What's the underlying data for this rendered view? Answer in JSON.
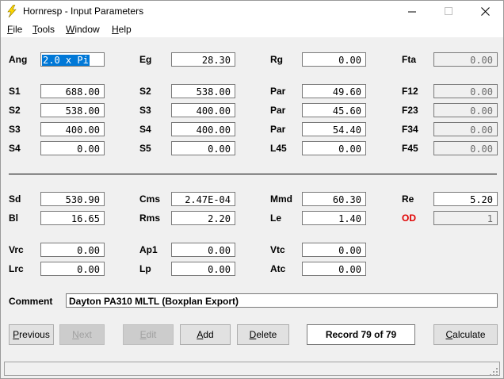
{
  "window": {
    "title": "Hornresp - Input Parameters",
    "minimize_glyph": "—",
    "maximize_glyph": "☐",
    "close_glyph": "✕",
    "icon": "lightning-bolt-icon",
    "icon_color": "#ffd800"
  },
  "menu": {
    "file": {
      "accel": "F",
      "rest": "ile"
    },
    "tools": {
      "accel": "T",
      "rest": "ools"
    },
    "window": {
      "accel": "W",
      "rest": "indow"
    },
    "help": {
      "accel": "H",
      "rest": "elp"
    }
  },
  "params": {
    "ang": {
      "label": "Ang",
      "value": "2.0 x Pi"
    },
    "eg": {
      "label": "Eg",
      "value": "28.30"
    },
    "rg": {
      "label": "Rg",
      "value": "0.00"
    },
    "fta": {
      "label": "Fta",
      "value": "0.00"
    },
    "s1a": {
      "label": "S1",
      "value": "688.00"
    },
    "s2b": {
      "label": "S2",
      "value": "538.00"
    },
    "par1": {
      "label": "Par",
      "value": "49.60"
    },
    "f12": {
      "label": "F12",
      "value": "0.00"
    },
    "s2a": {
      "label": "S2",
      "value": "538.00"
    },
    "s3b": {
      "label": "S3",
      "value": "400.00"
    },
    "par2": {
      "label": "Par",
      "value": "45.60"
    },
    "f23": {
      "label": "F23",
      "value": "0.00"
    },
    "s3a": {
      "label": "S3",
      "value": "400.00"
    },
    "s4b": {
      "label": "S4",
      "value": "400.00"
    },
    "par3": {
      "label": "Par",
      "value": "54.40"
    },
    "f34": {
      "label": "F34",
      "value": "0.00"
    },
    "s4a": {
      "label": "S4",
      "value": "0.00"
    },
    "s5": {
      "label": "S5",
      "value": "0.00"
    },
    "l45": {
      "label": "L45",
      "value": "0.00"
    },
    "f45": {
      "label": "F45",
      "value": "0.00"
    },
    "sd": {
      "label": "Sd",
      "value": "530.90"
    },
    "cms": {
      "label": "Cms",
      "value": "2.47E-04"
    },
    "mmd": {
      "label": "Mmd",
      "value": "60.30"
    },
    "re": {
      "label": "Re",
      "value": "5.20"
    },
    "bl": {
      "label": "Bl",
      "value": "16.65"
    },
    "rms": {
      "label": "Rms",
      "value": "2.20"
    },
    "le": {
      "label": "Le",
      "value": "1.40"
    },
    "od": {
      "label": "OD",
      "value": "1",
      "label_color": "#e00000"
    },
    "vrc": {
      "label": "Vrc",
      "value": "0.00"
    },
    "ap1": {
      "label": "Ap1",
      "value": "0.00"
    },
    "vtc": {
      "label": "Vtc",
      "value": "0.00"
    },
    "lrc": {
      "label": "Lrc",
      "value": "0.00"
    },
    "lp": {
      "label": "Lp",
      "value": "0.00"
    },
    "atc": {
      "label": "Atc",
      "value": "0.00"
    }
  },
  "comment": {
    "label": "Comment",
    "value": "Dayton PA310 MLTL (Boxplan Export)"
  },
  "buttons": {
    "previous": {
      "accel": "P",
      "rest": "revious"
    },
    "next": {
      "accel": "N",
      "rest": "ext"
    },
    "edit": {
      "accel": "E",
      "rest": "dit"
    },
    "add": {
      "accel": "A",
      "rest": "dd"
    },
    "delete": {
      "accel": "D",
      "rest": "elete"
    },
    "calculate": {
      "accel": "C",
      "rest": "alculate"
    }
  },
  "record": "Record 79 of 79",
  "colors": {
    "selection": "#0078d7",
    "od_label": "#e00000"
  }
}
